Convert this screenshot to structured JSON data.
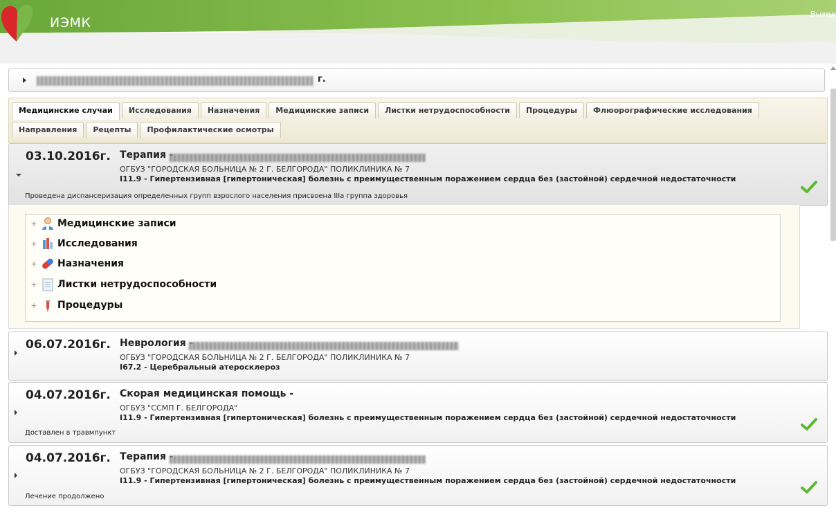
{
  "app": {
    "title": "ИЭМК",
    "logout": "Выход"
  },
  "patient": {
    "suffix": "г."
  },
  "tabs": {
    "row1": [
      "Медицинские случаи",
      "Исследования",
      "Назначения",
      "Медицинские записи",
      "Листки нетрудоспособности",
      "Процедуры",
      "Флюорографические исследования"
    ],
    "row2": [
      "Направления",
      "Рецепты",
      "Профилактические осмотры"
    ],
    "active": "Медицинские случаи"
  },
  "cases": [
    {
      "date": "03.10.2016г.",
      "specialty": "Терапия -",
      "org": "ОГБУЗ \"ГОРОДСКАЯ БОЛЬНИЦА № 2 Г. БЕЛГОРОДА\" ПОЛИКЛИНИКА № 7",
      "diagnosis_code": "I11.9",
      "diagnosis_text": " - Гипертензивная [гипертоническая] болезнь с преимущественным поражением сердца без (застойной) сердечной недостаточности",
      "note": "Проведена диспансеризация определенных групп взрослого населения присвоена IIIа группа здоровья",
      "expanded": true,
      "checked": true
    },
    {
      "date": "06.07.2016г.",
      "specialty": "Неврология -",
      "org": "ОГБУЗ \"ГОРОДСКАЯ БОЛЬНИЦА № 2 Г. БЕЛГОРОДА\" ПОЛИКЛИНИКА № 7",
      "diagnosis_code": "I67.2",
      "diagnosis_text": " - Церебральный атеросклероз",
      "note": "",
      "expanded": false,
      "checked": false
    },
    {
      "date": "04.07.2016г.",
      "specialty": "Скорая медицинская помощь -",
      "org": "ОГБУЗ \"ССМП Г. БЕЛГОРОДА\"",
      "diagnosis_code": "I11.9",
      "diagnosis_text": " - Гипертензивная [гипертоническая] болезнь с преимущественным поражением сердца без (застойной) сердечной недостаточности",
      "note": "Доставлен в травмпункт",
      "expanded": false,
      "checked": true
    },
    {
      "date": "04.07.2016г.",
      "specialty": "Терапия -",
      "org": "ОГБУЗ \"ГОРОДСКАЯ БОЛЬНИЦА № 2 Г. БЕЛГОРОДА\" ПОЛИКЛИНИКА № 7",
      "diagnosis_code": "I11.9",
      "diagnosis_text": " - Гипертензивная [гипертоническая] болезнь с преимущественным поражением сердца без (застойной) сердечной недостаточности",
      "note": "Лечение продолжено",
      "expanded": false,
      "checked": true
    }
  ],
  "tree": [
    {
      "label": "Медицинские записи",
      "icon": "doctor-icon"
    },
    {
      "label": "Исследования",
      "icon": "lab-flask-icon"
    },
    {
      "label": "Назначения",
      "icon": "pill-icon"
    },
    {
      "label": "Листки нетрудоспособности",
      "icon": "document-icon"
    },
    {
      "label": "Процедуры",
      "icon": "syringe-icon"
    }
  ],
  "colors": {
    "brand_green": "#7ab648",
    "check_green": "#5cb82e",
    "logo_red": "#d8262b"
  }
}
